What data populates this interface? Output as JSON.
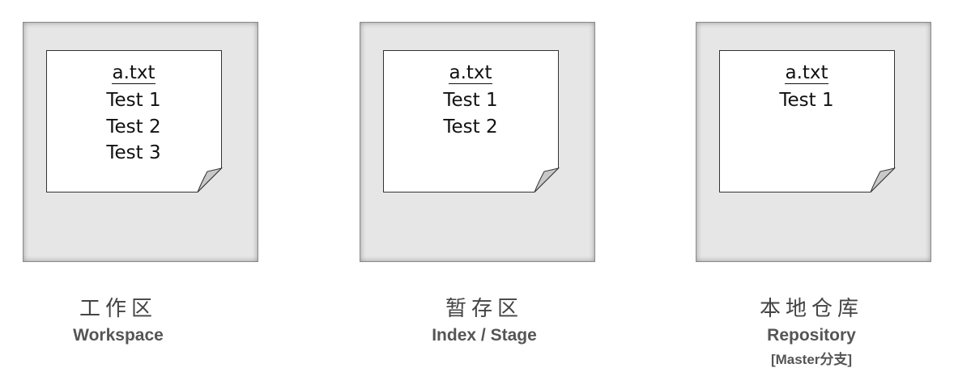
{
  "areas": [
    {
      "file": {
        "name": "a.txt",
        "lines": [
          "Test 1",
          "Test 2",
          "Test 3"
        ]
      },
      "label_cn": "工作区",
      "label_en": "Workspace"
    },
    {
      "file": {
        "name": "a.txt",
        "lines": [
          "Test 1",
          "Test 2"
        ]
      },
      "label_cn": "暂存区",
      "label_en": "Index / Stage"
    },
    {
      "file": {
        "name": "a.txt",
        "lines": [
          "Test 1"
        ]
      },
      "label_cn": "本地仓库",
      "label_en": "Repository",
      "branch": "[Master分支]"
    }
  ],
  "colors": {
    "panel_fill": "#e6e6e6",
    "panel_border": "#8a8a8a",
    "note_fill": "#ffffff",
    "curl_fill": "#c8c8c8",
    "caption_text": "#555555"
  },
  "icons": [
    "document-curl-icon"
  ]
}
